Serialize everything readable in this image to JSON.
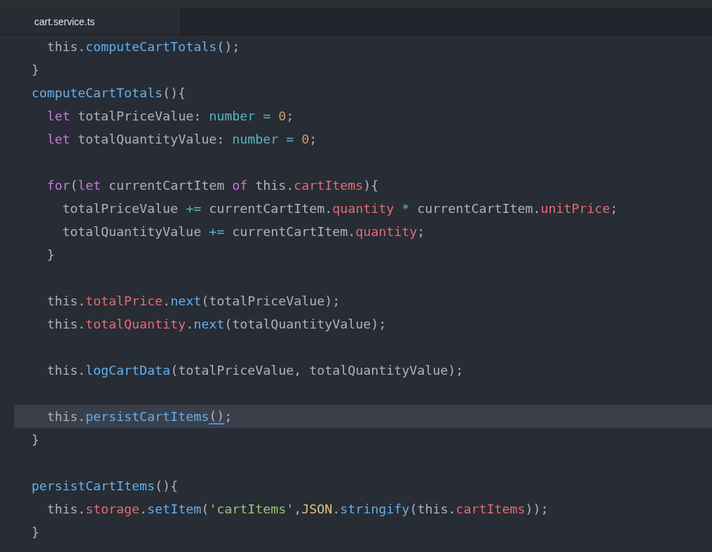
{
  "tabs": [
    {
      "label": "cart.service.ts",
      "selected": true
    }
  ],
  "editor": {
    "lines": [
      {
        "kind": "code",
        "current": false,
        "tokens": [
          {
            "kind": "plain",
            "text": "  this."
          },
          {
            "kind": "func",
            "text": "computeCartTotals"
          },
          {
            "kind": "punct",
            "text": "();"
          }
        ]
      },
      {
        "kind": "code",
        "current": false,
        "tokens": [
          {
            "kind": "punct",
            "text": "}"
          }
        ]
      },
      {
        "kind": "code",
        "current": false,
        "tokens": [
          {
            "kind": "func",
            "text": "computeCartTotals"
          },
          {
            "kind": "punct",
            "text": "(){"
          }
        ]
      },
      {
        "kind": "code",
        "current": false,
        "tokens": [
          {
            "kind": "keyword",
            "text": "  let "
          },
          {
            "kind": "plain",
            "text": "totalPriceValue: "
          },
          {
            "kind": "type",
            "text": "number"
          },
          {
            "kind": "op",
            "text": " = "
          },
          {
            "kind": "number",
            "text": "0"
          },
          {
            "kind": "punct",
            "text": ";"
          }
        ]
      },
      {
        "kind": "code",
        "current": false,
        "tokens": [
          {
            "kind": "keyword",
            "text": "  let "
          },
          {
            "kind": "plain",
            "text": "totalQuantityValue: "
          },
          {
            "kind": "type",
            "text": "number"
          },
          {
            "kind": "op",
            "text": " = "
          },
          {
            "kind": "number",
            "text": "0"
          },
          {
            "kind": "punct",
            "text": ";"
          }
        ]
      },
      {
        "kind": "blank"
      },
      {
        "kind": "code",
        "current": false,
        "tokens": [
          {
            "kind": "keyword",
            "text": "  for"
          },
          {
            "kind": "punct",
            "text": "("
          },
          {
            "kind": "keyword",
            "text": "let "
          },
          {
            "kind": "plain",
            "text": "currentCartItem "
          },
          {
            "kind": "keyword",
            "text": "of "
          },
          {
            "kind": "plain",
            "text": "this."
          },
          {
            "kind": "prop",
            "text": "cartItems"
          },
          {
            "kind": "punct",
            "text": "){"
          }
        ]
      },
      {
        "kind": "code",
        "current": false,
        "tokens": [
          {
            "kind": "plain",
            "text": "    totalPriceValue "
          },
          {
            "kind": "op",
            "text": "+="
          },
          {
            "kind": "plain",
            "text": " currentCartItem."
          },
          {
            "kind": "prop",
            "text": "quantity"
          },
          {
            "kind": "op",
            "text": " * "
          },
          {
            "kind": "plain",
            "text": "currentCartItem."
          },
          {
            "kind": "prop",
            "text": "unitPrice"
          },
          {
            "kind": "punct",
            "text": ";"
          }
        ]
      },
      {
        "kind": "code",
        "current": false,
        "tokens": [
          {
            "kind": "plain",
            "text": "    totalQuantityValue "
          },
          {
            "kind": "op",
            "text": "+="
          },
          {
            "kind": "plain",
            "text": " currentCartItem."
          },
          {
            "kind": "prop",
            "text": "quantity"
          },
          {
            "kind": "punct",
            "text": ";"
          }
        ]
      },
      {
        "kind": "code",
        "current": false,
        "tokens": [
          {
            "kind": "punct",
            "text": "  }"
          }
        ]
      },
      {
        "kind": "blank"
      },
      {
        "kind": "code",
        "current": false,
        "tokens": [
          {
            "kind": "plain",
            "text": "  this."
          },
          {
            "kind": "prop",
            "text": "totalPrice"
          },
          {
            "kind": "plain",
            "text": "."
          },
          {
            "kind": "func",
            "text": "next"
          },
          {
            "kind": "punct",
            "text": "(totalPriceValue);"
          }
        ]
      },
      {
        "kind": "code",
        "current": false,
        "tokens": [
          {
            "kind": "plain",
            "text": "  this."
          },
          {
            "kind": "prop",
            "text": "totalQuantity"
          },
          {
            "kind": "plain",
            "text": "."
          },
          {
            "kind": "func",
            "text": "next"
          },
          {
            "kind": "punct",
            "text": "(totalQuantityValue);"
          }
        ]
      },
      {
        "kind": "blank"
      },
      {
        "kind": "code",
        "current": false,
        "tokens": [
          {
            "kind": "plain",
            "text": "  this."
          },
          {
            "kind": "func",
            "text": "logCartData"
          },
          {
            "kind": "punct",
            "text": "(totalPriceValue, totalQuantityValue);"
          }
        ]
      },
      {
        "kind": "blank"
      },
      {
        "kind": "code",
        "current": true,
        "tokens": [
          {
            "kind": "plain",
            "text": "  this."
          },
          {
            "kind": "func",
            "text": "persistCartItems"
          },
          {
            "kind": "match",
            "text": "()"
          },
          {
            "kind": "punct",
            "text": ";"
          }
        ]
      },
      {
        "kind": "code",
        "current": false,
        "tokens": [
          {
            "kind": "punct",
            "text": "}"
          }
        ]
      },
      {
        "kind": "blank"
      },
      {
        "kind": "code",
        "current": false,
        "tokens": [
          {
            "kind": "func",
            "text": "persistCartItems"
          },
          {
            "kind": "punct",
            "text": "(){"
          }
        ]
      },
      {
        "kind": "code",
        "current": false,
        "tokens": [
          {
            "kind": "plain",
            "text": "  this."
          },
          {
            "kind": "prop",
            "text": "storage"
          },
          {
            "kind": "plain",
            "text": "."
          },
          {
            "kind": "func",
            "text": "setItem"
          },
          {
            "kind": "punct",
            "text": "("
          },
          {
            "kind": "string",
            "text": "'cartItems'"
          },
          {
            "kind": "punct",
            "text": ","
          },
          {
            "kind": "class",
            "text": "JSON"
          },
          {
            "kind": "plain",
            "text": "."
          },
          {
            "kind": "func",
            "text": "stringify"
          },
          {
            "kind": "punct",
            "text": "(this."
          },
          {
            "kind": "prop",
            "text": "cartItems"
          },
          {
            "kind": "punct",
            "text": "));"
          }
        ]
      },
      {
        "kind": "code",
        "current": false,
        "tokens": [
          {
            "kind": "punct",
            "text": "}"
          }
        ]
      }
    ]
  }
}
